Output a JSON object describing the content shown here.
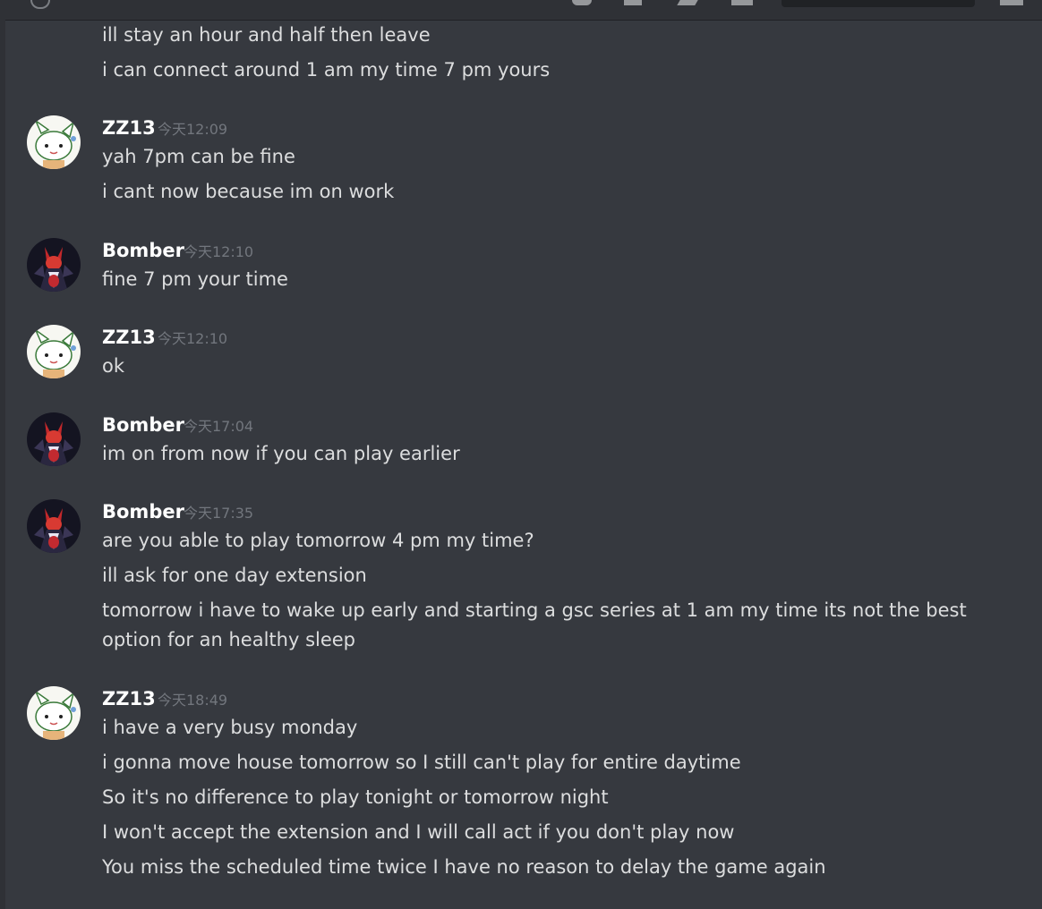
{
  "colors": {
    "background": "#36393f",
    "text": "#dcddde",
    "author": "#ffffff",
    "timestamp": "#72767d"
  },
  "continuation": [
    "ill stay an hour and half then leave",
    "i can connect around 1 am my time 7 pm yours"
  ],
  "groups": [
    {
      "author": "ZZ13",
      "avatar": "cat-avatar-icon",
      "time": "今天12:09",
      "lines": [
        "yah 7pm can be fine",
        "i cant now because im on work"
      ]
    },
    {
      "author": "Bomber",
      "avatar": "demon-avatar-icon",
      "time": "今天12:10",
      "lines": [
        "fine 7 pm your time"
      ]
    },
    {
      "author": "ZZ13",
      "avatar": "cat-avatar-icon",
      "time": "今天12:10",
      "lines": [
        "ok"
      ]
    },
    {
      "author": "Bomber",
      "avatar": "demon-avatar-icon",
      "time": "今天17:04",
      "lines": [
        "im on from now if you can play earlier"
      ]
    },
    {
      "author": "Bomber",
      "avatar": "demon-avatar-icon",
      "time": "今天17:35",
      "lines": [
        "are you able to play tomorrow 4 pm my time?",
        "ill ask for one day extension",
        "tomorrow i have to wake up early and starting a gsc series at 1 am my time its not the best option for an healthy sleep"
      ]
    },
    {
      "author": "ZZ13",
      "avatar": "cat-avatar-icon",
      "time": "今天18:49",
      "lines": [
        "i have a very busy monday",
        "i gonna move house tomorrow so I still can't play for entire daytime",
        "So it's no difference to play tonight or tomorrow night",
        "I won't accept the extension and I will call act if you don't play now",
        "You miss the scheduled time twice I have no reason to delay the game again"
      ]
    }
  ]
}
